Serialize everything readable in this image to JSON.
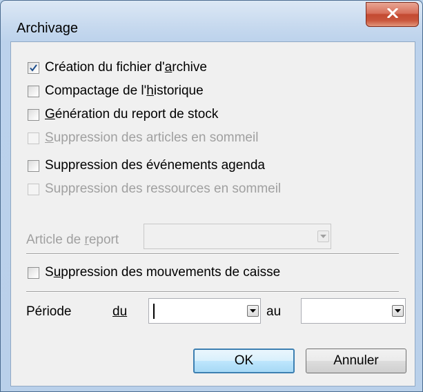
{
  "window": {
    "title": "Archivage",
    "close_icon": "close-icon"
  },
  "options": [
    {
      "pre": "Création du fichier d'",
      "u": "a",
      "post": "rchive",
      "checked": true,
      "enabled": true
    },
    {
      "pre": "Compactage de l'",
      "u": "h",
      "post": "istorique",
      "checked": false,
      "enabled": true
    },
    {
      "pre": "",
      "u": "G",
      "post": "énération du report de stock",
      "checked": false,
      "enabled": true
    },
    {
      "pre": "",
      "u": "S",
      "post": "uppression des articles en sommeil",
      "checked": false,
      "enabled": false
    },
    {
      "pre": "Suppression des événements agenda",
      "u": "",
      "post": "",
      "checked": false,
      "enabled": true
    },
    {
      "pre": "Suppression des ressources en sommeil",
      "u": "",
      "post": "",
      "checked": false,
      "enabled": false
    }
  ],
  "article_report": {
    "pre": "Article de ",
    "u": "r",
    "post": "eport",
    "value": "",
    "enabled": false
  },
  "mouvements_caisse": {
    "pre": "S",
    "u": "u",
    "post": "ppression des mouvements de caisse",
    "checked": false
  },
  "periode": {
    "label": "Période",
    "du_label": "du",
    "du_value": "",
    "au_label": "au",
    "au_value": ""
  },
  "buttons": {
    "ok": "OK",
    "cancel": "Annuler"
  },
  "colors": {
    "accent": "#3c7fb1",
    "check": "#1c4d8c",
    "close": "#c34a32"
  }
}
